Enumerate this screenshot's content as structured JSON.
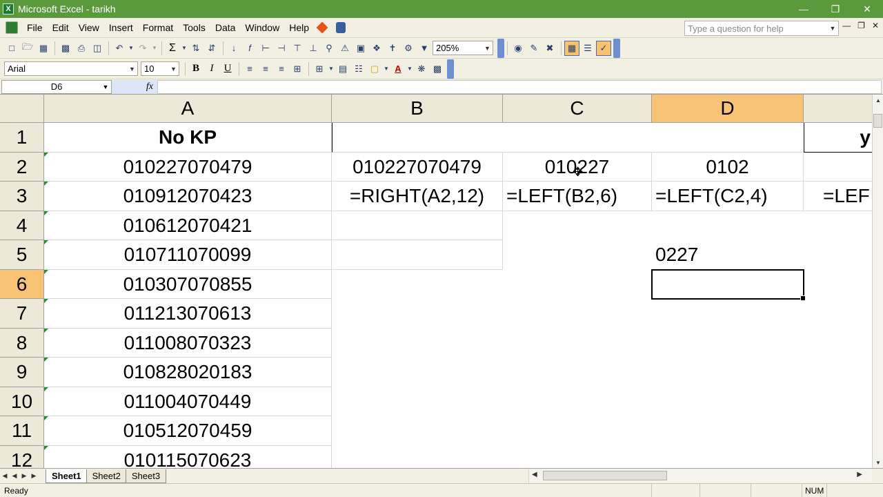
{
  "window": {
    "title": "Microsoft Excel - tarikh"
  },
  "menu": [
    "File",
    "Edit",
    "View",
    "Insert",
    "Format",
    "Tools",
    "Data",
    "Window",
    "Help"
  ],
  "help_box": {
    "placeholder": "Type a question for help"
  },
  "toolbar": {
    "zoom": "205%"
  },
  "format_toolbar": {
    "font": "Arial",
    "size": "10",
    "bold": "B",
    "italic": "I",
    "underline": "U"
  },
  "formula_bar": {
    "name_box": "D6",
    "fx_label": "fx",
    "formula": ""
  },
  "columns": [
    "A",
    "B",
    "C",
    "D"
  ],
  "rows": [
    "1",
    "2",
    "3",
    "4",
    "5",
    "6",
    "7",
    "8",
    "9",
    "10",
    "11",
    "12"
  ],
  "selected": {
    "column": "D",
    "row": "6"
  },
  "cells": {
    "A1": "No KP",
    "A2": "010227070479",
    "A3": "010912070423",
    "A4": "010612070421",
    "A5": "010711070099",
    "A6": "010307070855",
    "A7": "011213070613",
    "A8": "011008070323",
    "A9": "010828020183",
    "A10": "011004070449",
    "A11": "010512070459",
    "A12": "010115070623",
    "B2": "010227070479",
    "B3": "=RIGHT(A2,12)",
    "C2": "010227",
    "C3": "=LEFT(B2,6)",
    "D2": "0102",
    "D3": "=LEFT(C2,4)",
    "D5": "0227",
    "E1": "y",
    "E3": "=LEF"
  },
  "sheets": [
    "Sheet1",
    "Sheet2",
    "Sheet3"
  ],
  "active_sheet": "Sheet1",
  "status": {
    "left": "Ready",
    "num": "NUM"
  },
  "colors": {
    "title_bar": "#5a9a3c",
    "selected_header": "#f8c374",
    "chrome": "#f2efe3"
  }
}
